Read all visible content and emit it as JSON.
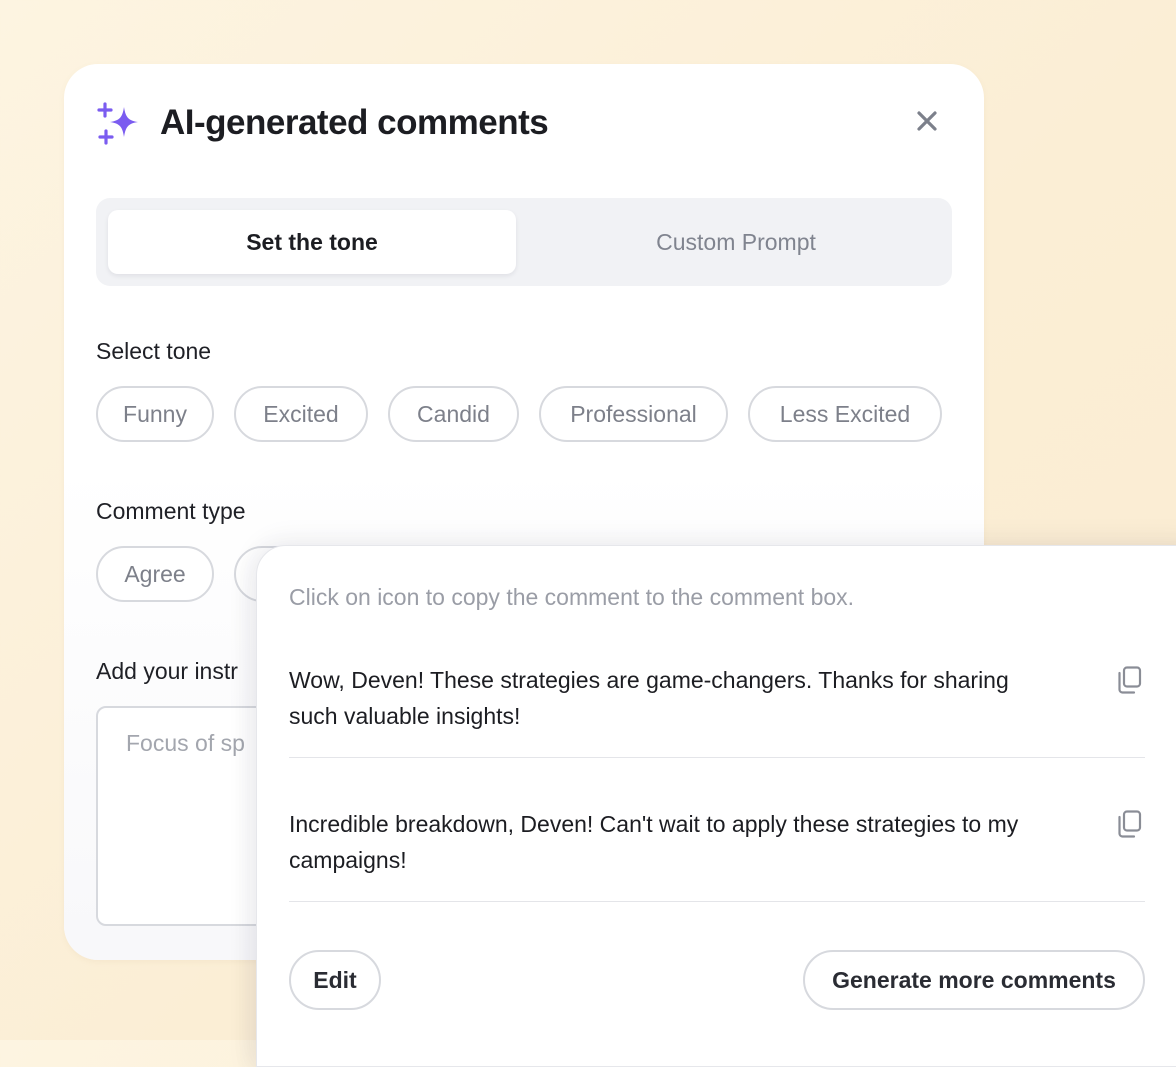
{
  "dialog": {
    "title": "AI-generated comments",
    "close_icon": "close-icon",
    "sparkle_icon": "sparkles-icon",
    "accent_color": "#7b5cf0"
  },
  "tabs": [
    {
      "label": "Set the tone",
      "active": true
    },
    {
      "label": "Custom Prompt",
      "active": false
    }
  ],
  "tone": {
    "label": "Select tone",
    "options": [
      "Funny",
      "Excited",
      "Candid",
      "Professional",
      "Less Excited"
    ]
  },
  "comment_type": {
    "label": "Comment type",
    "options": [
      "Agree"
    ]
  },
  "instructions": {
    "label": "Add your instr",
    "placeholder": "Focus of sp"
  },
  "results": {
    "hint": "Click on icon to copy the comment to the comment box.",
    "comments": [
      {
        "text": "Wow, Deven! These strategies are game-changers. Thanks for sharing such valuable insights!",
        "icon": "copy-icon"
      },
      {
        "text": "Incredible breakdown, Deven! Can't wait to apply these strategies to my campaigns!",
        "icon": "copy-icon"
      }
    ],
    "edit_label": "Edit",
    "generate_label": "Generate more comments"
  }
}
